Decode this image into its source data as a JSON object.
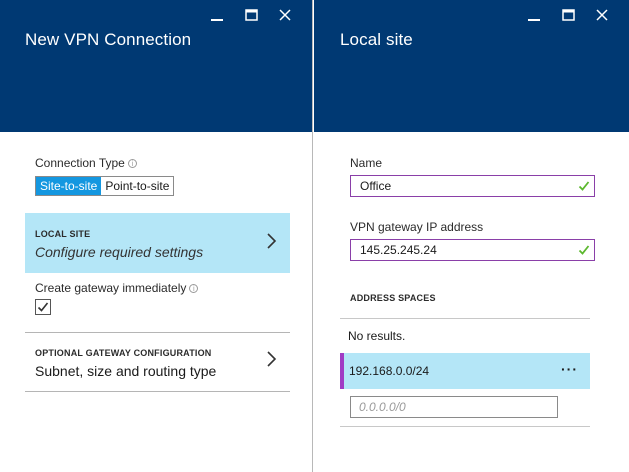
{
  "colors": {
    "header": "#003973",
    "accent": "#1497e0",
    "selected_row": "#b4e6f7",
    "input_border": "#8a3fa8",
    "valid_check": "#5cb82e",
    "row_accent": "#a03cc4"
  },
  "left_blade": {
    "title": "New VPN Connection",
    "window_controls": [
      "minimize-icon",
      "maximize-icon",
      "close-icon"
    ],
    "connection_type": {
      "label": "Connection Type",
      "info": "i",
      "options": [
        "Site-to-site",
        "Point-to-site"
      ],
      "selected": "Site-to-site"
    },
    "local_site": {
      "kicker": "LOCAL SITE",
      "text": "Configure required settings"
    },
    "create_gateway": {
      "label": "Create gateway immediately",
      "info": "i",
      "checked": true
    },
    "optional_gateway": {
      "kicker": "OPTIONAL GATEWAY CONFIGURATION",
      "text": "Subnet, size and routing type"
    }
  },
  "right_blade": {
    "title": "Local site",
    "window_controls": [
      "minimize-icon",
      "maximize-icon",
      "close-icon"
    ],
    "name": {
      "label": "Name",
      "value": "Office",
      "valid": true
    },
    "vpn_gateway": {
      "label": "VPN gateway IP address",
      "value": "145.25.245.24",
      "valid": true
    },
    "address_spaces": {
      "title": "ADDRESS SPACES",
      "empty_text": "No results.",
      "items": [
        {
          "value": "192.168.0.0/24",
          "more": "···"
        }
      ],
      "new_placeholder": "0.0.0.0/0"
    }
  }
}
